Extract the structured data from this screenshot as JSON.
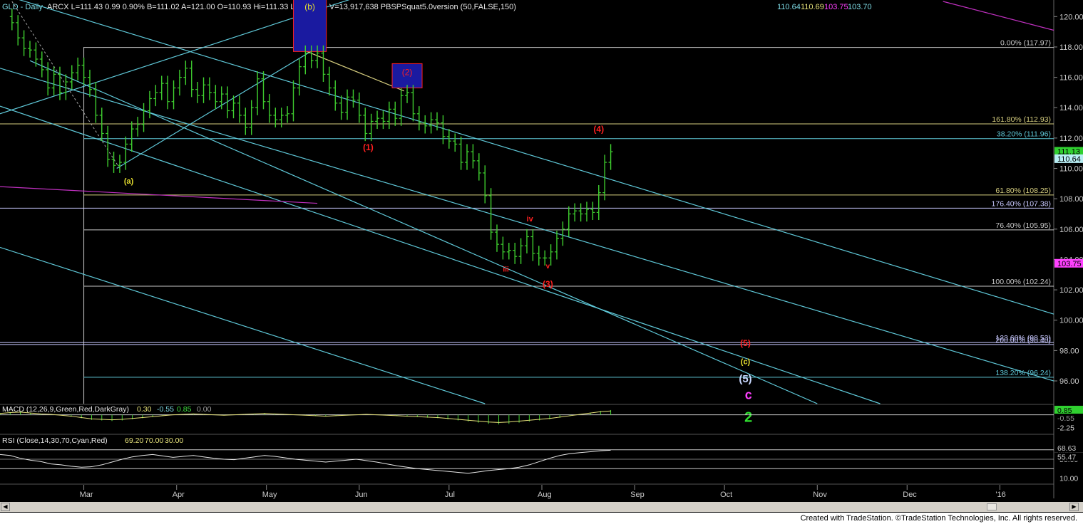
{
  "header": {
    "symbol": "GLD - Daily",
    "quote": "ARCX  L=111.43  0.99  0.90%  B=111.02  A=121.00  O=110.93  Hi=111.33  Lo=110.12  V=13,917,638  PBSPSquat5.0version (50,FALSE,150)",
    "ind_values": [
      {
        "text": "110.64",
        "color": "#7fdce6"
      },
      {
        "text": "110.69",
        "color": "#e6e27a"
      },
      {
        "text": "103.75",
        "color": "#ff40ff"
      },
      {
        "text": "103.70",
        "color": "#7fdce6"
      }
    ]
  },
  "colors": {
    "background": "#000000",
    "bars": "#3fcf2f",
    "channel": "#5fc8d8",
    "fib_grid": "#c8c8c8",
    "fib_tan": "#d8d080",
    "magenta": "#c030c0",
    "red_label": "#ff2020",
    "yellow_label": "#e8e030",
    "macd_zero": "#c8c8c8",
    "rsi": "#c8c8c8"
  },
  "chart_data": {
    "type": "ohlc",
    "symbol": "GLD",
    "interval": "Daily",
    "ylim": [
      94.5,
      121
    ],
    "y_ticks": [
      96,
      98,
      100,
      102,
      104,
      106,
      108,
      110,
      112,
      114,
      116,
      118,
      120
    ],
    "y_tick_labels": [
      "96.00",
      "98.00",
      "100.00",
      "102.00",
      "104.00",
      "106.00",
      "108.00",
      "110.00",
      "112.00",
      "114.00",
      "116.00",
      "118.00",
      "120.00"
    ],
    "x_months": [
      {
        "label": "Mar",
        "day": 28
      },
      {
        "label": "Apr",
        "day": 59
      },
      {
        "label": "May",
        "day": 89
      },
      {
        "label": "Jun",
        "day": 120
      },
      {
        "label": "Jul",
        "day": 150
      },
      {
        "label": "Aug",
        "day": 181
      },
      {
        "label": "Sep",
        "day": 212
      },
      {
        "label": "Oct",
        "day": 242
      },
      {
        "label": "Nov",
        "day": 273
      },
      {
        "label": "Dec",
        "day": 303
      },
      {
        "label": "'16",
        "day": 334
      }
    ],
    "x_range_days": [
      0,
      352
    ],
    "closes": [
      [
        4,
        119.6
      ],
      [
        6,
        118.6
      ],
      [
        8,
        117.9
      ],
      [
        10,
        117.8
      ],
      [
        12,
        117.2
      ],
      [
        14,
        116.5
      ],
      [
        16,
        115.3
      ],
      [
        18,
        116.2
      ],
      [
        20,
        115.0
      ],
      [
        22,
        115.7
      ],
      [
        24,
        116.3
      ],
      [
        26,
        116.8
      ],
      [
        28,
        116.0
      ],
      [
        30,
        115.2
      ],
      [
        32,
        113.5
      ],
      [
        34,
        112.3
      ],
      [
        36,
        110.6
      ],
      [
        38,
        110.2
      ],
      [
        40,
        110.4
      ],
      [
        42,
        111.6
      ],
      [
        44,
        112.6
      ],
      [
        46,
        112.9
      ],
      [
        48,
        113.8
      ],
      [
        50,
        114.6
      ],
      [
        52,
        115.0
      ],
      [
        54,
        115.6
      ],
      [
        56,
        114.4
      ],
      [
        58,
        115.3
      ],
      [
        60,
        116.0
      ],
      [
        62,
        116.6
      ],
      [
        64,
        115.2
      ],
      [
        66,
        114.8
      ],
      [
        68,
        115.5
      ],
      [
        70,
        115.0
      ],
      [
        72,
        114.4
      ],
      [
        74,
        114.9
      ],
      [
        76,
        113.8
      ],
      [
        78,
        114.3
      ],
      [
        80,
        113.5
      ],
      [
        82,
        112.7
      ],
      [
        84,
        114.0
      ],
      [
        86,
        115.9
      ],
      [
        88,
        114.4
      ],
      [
        90,
        113.5
      ],
      [
        92,
        113.2
      ],
      [
        94,
        113.5
      ],
      [
        96,
        113.6
      ],
      [
        98,
        115.3
      ],
      [
        100,
        116.7
      ],
      [
        102,
        117.6
      ],
      [
        104,
        117.1
      ],
      [
        106,
        117.6
      ],
      [
        108,
        116.2
      ],
      [
        110,
        115.3
      ],
      [
        112,
        114.3
      ],
      [
        114,
        113.7
      ],
      [
        116,
        114.7
      ],
      [
        118,
        114.5
      ],
      [
        120,
        113.5
      ],
      [
        122,
        112.3
      ],
      [
        124,
        113.1
      ],
      [
        126,
        113.3
      ],
      [
        128,
        113.1
      ],
      [
        130,
        113.9
      ],
      [
        132,
        113.3
      ],
      [
        134,
        114.8
      ],
      [
        136,
        115.0
      ],
      [
        138,
        113.6
      ],
      [
        140,
        113.0
      ],
      [
        142,
        112.8
      ],
      [
        144,
        113.2
      ],
      [
        146,
        113.0
      ],
      [
        148,
        112.1
      ],
      [
        150,
        111.8
      ],
      [
        152,
        111.6
      ],
      [
        154,
        110.4
      ],
      [
        156,
        111.1
      ],
      [
        158,
        110.5
      ],
      [
        160,
        109.7
      ],
      [
        162,
        108.2
      ],
      [
        164,
        105.8
      ],
      [
        166,
        105.0
      ],
      [
        168,
        104.5
      ],
      [
        170,
        104.6
      ],
      [
        172,
        104.2
      ],
      [
        174,
        104.9
      ],
      [
        176,
        105.5
      ],
      [
        178,
        104.4
      ],
      [
        180,
        104.1
      ],
      [
        182,
        104.1
      ],
      [
        184,
        104.5
      ],
      [
        186,
        105.4
      ],
      [
        188,
        106.0
      ],
      [
        190,
        107.0
      ],
      [
        192,
        107.2
      ],
      [
        194,
        107.0
      ],
      [
        196,
        107.3
      ],
      [
        198,
        107.1
      ],
      [
        200,
        108.4
      ],
      [
        202,
        110.4
      ],
      [
        204,
        111.1
      ]
    ],
    "fib_levels": [
      {
        "label": "0.00% (117.97)",
        "value": 117.97,
        "color": "#c8c8c8",
        "x_start_day": 28
      },
      {
        "label": "161.80% (112.93)",
        "value": 112.93,
        "color": "#d8d080",
        "x_start_day": 0
      },
      {
        "label": "38.20% (111.96)",
        "value": 111.96,
        "color": "#5fc8d8",
        "x_start_day": 28
      },
      {
        "label": "61.80% (108.25)",
        "value": 108.25,
        "color": "#d8d080",
        "x_start_day": 28
      },
      {
        "label": "176.40% (107.38)",
        "value": 107.38,
        "color": "#c8c8ff",
        "x_start_day": 0
      },
      {
        "label": "76.40% (105.95)",
        "value": 105.95,
        "color": "#c8c8c8",
        "x_start_day": 28
      },
      {
        "label": "100.00% (102.24)",
        "value": 102.24,
        "color": "#c8c8c8",
        "x_start_day": 28
      },
      {
        "label": "123.60% (98.53)",
        "value": 98.53,
        "color": "#c8c8ff",
        "x_start_day": 0
      },
      {
        "label": "200.00% (98.40)",
        "value": 98.4,
        "color": "#c8c8ff",
        "x_start_day": 0
      },
      {
        "label": "138.20% (96.24)",
        "value": 96.24,
        "color": "#5fc8d8",
        "x_start_day": 28
      }
    ],
    "channel_lines": [
      [
        [
          0,
          121.5
        ],
        [
          352,
          100.4
        ]
      ],
      [
        [
          0,
          116.6
        ],
        [
          352,
          96.0
        ]
      ],
      [
        [
          10,
          117.1
        ],
        [
          273,
          94.5
        ]
      ],
      [
        [
          0,
          114.1
        ],
        [
          294,
          94.5
        ]
      ],
      [
        [
          0,
          104.8
        ],
        [
          162,
          94.5
        ]
      ],
      [
        [
          0,
          113.6
        ],
        [
          118,
          121.2
        ]
      ],
      [
        [
          39,
          110.0
        ],
        [
          108,
          118.2
        ]
      ]
    ],
    "fan_lines": [
      [
        [
          100,
          117.9
        ],
        [
          135,
          115.1
        ]
      ],
      [
        [
          0,
          108.8
        ],
        [
          106,
          107.7
        ]
      ],
      [
        [
          315,
          121.0
        ],
        [
          352,
          119.1
        ]
      ]
    ],
    "boxes": [
      {
        "label": "(b)",
        "day0": 98,
        "day1": 109,
        "v0": 117.7,
        "v1": 121.2,
        "label_color": "#e8e030"
      },
      {
        "label": "(2)",
        "day0": 131,
        "day1": 141,
        "v0": 115.3,
        "v1": 116.9,
        "label_color": "#ff2020"
      }
    ],
    "wave_labels": [
      {
        "text": "(a)",
        "day": 43,
        "value": 109.0,
        "color": "#e8e030",
        "size": 11
      },
      {
        "text": "(1)",
        "day": 123,
        "value": 111.2,
        "color": "#ff2020",
        "size": 12
      },
      {
        "text": "(4)",
        "day": 200,
        "value": 112.4,
        "color": "#ff2020",
        "size": 12
      },
      {
        "text": "iv",
        "day": 177,
        "value": 106.5,
        "color": "#ff2020",
        "size": 11
      },
      {
        "text": "iii",
        "day": 169,
        "value": 103.2,
        "color": "#ff2020",
        "size": 10
      },
      {
        "text": "v",
        "day": 183,
        "value": 103.4,
        "color": "#ff2020",
        "size": 10
      },
      {
        "text": "(3)",
        "day": 183,
        "value": 102.2,
        "color": "#ff2020",
        "size": 12
      },
      {
        "text": "(5)",
        "day": 249,
        "value": 98.3,
        "color": "#ff2020",
        "size": 12
      },
      {
        "text": "(c)",
        "day": 249,
        "value": 97.1,
        "color": "#e8e030",
        "size": 11
      },
      {
        "text": "(5)",
        "day": 249,
        "value": 95.9,
        "color": "#c8d8ff",
        "size": 15
      },
      {
        "text": "c",
        "day": 250,
        "value": 94.8,
        "color": "#ff40ff",
        "size": 18
      },
      {
        "text": "2",
        "day": 250,
        "value": 93.3,
        "color": "#30e030",
        "size": 20
      }
    ],
    "price_tags": [
      {
        "text": "111.13",
        "value": 111.13,
        "bg": "#30d030",
        "fg": "#000"
      },
      {
        "text": "110.64",
        "value": 110.64,
        "bg": "#b8eef4",
        "fg": "#000"
      },
      {
        "text": "103.75",
        "value": 103.75,
        "bg": "#ff40ff",
        "fg": "#000"
      }
    ],
    "macd": {
      "title": "MACD (12,26,9,Green,Red,DarkGray)",
      "values": [
        {
          "text": "0.30",
          "color": "#e6e27a"
        },
        {
          "text": "-0.55",
          "color": "#7fdce6"
        },
        {
          "text": "0.85",
          "color": "#40e040"
        },
        {
          "text": "0.00",
          "color": "#a0a0a0"
        }
      ],
      "ylim": [
        -3.2,
        1.6
      ],
      "tags": [
        {
          "text": "0.85",
          "value": 0.85,
          "bg": "#30d030",
          "fg": "#000"
        },
        {
          "text": "-2.25",
          "value": -2.25,
          "bg": "#000",
          "fg": "#ddd"
        },
        {
          "text": "-0.55",
          "value": -0.55,
          "bg": "#000",
          "fg": "#999"
        }
      ],
      "hist": [
        0.3,
        0.5,
        0.6,
        0.4,
        0.2,
        0.1,
        -0.1,
        -0.3,
        -0.6,
        -0.9,
        -1.0,
        -1.1,
        -1.0,
        -0.8,
        -0.6,
        -0.4,
        -0.2,
        0.0,
        0.1,
        0.2,
        0.1,
        0.0,
        -0.1,
        0.0,
        0.1,
        0.2,
        0.3,
        0.2,
        0.1,
        0.0,
        -0.1,
        -0.2,
        -0.3,
        -0.2,
        -0.1,
        0.0,
        0.1,
        0.0,
        -0.1,
        -0.2,
        -0.3,
        -0.4,
        -0.5,
        -0.6,
        -0.8,
        -1.0,
        -1.2,
        -1.4,
        -1.6,
        -1.7,
        -1.6,
        -1.4,
        -1.2,
        -1.0,
        -0.8,
        -0.5,
        -0.2,
        0.1,
        0.4,
        0.7,
        0.85
      ]
    },
    "rsi": {
      "title": "RSI (Close,14,30,70,Cyan,Red)",
      "values": [
        {
          "text": "69.20",
          "color": "#e6e27a"
        },
        {
          "text": "70.00",
          "color": "#e6e27a"
        },
        {
          "text": "30.00",
          "color": "#e6e27a"
        }
      ],
      "ylim": [
        0,
        100
      ],
      "ticks": [
        {
          "text": "10.00",
          "value": 10
        },
        {
          "text": "50.00",
          "value": 50
        }
      ],
      "tags": [
        {
          "text": "69.20",
          "value": 69.2,
          "bg": "#a0a0a0",
          "fg": "#000"
        },
        {
          "text": "68.63",
          "value": 74,
          "bg": "#000",
          "fg": "#ccc"
        },
        {
          "text": "55.47",
          "value": 55.5,
          "bg": "#000",
          "fg": "#ccc"
        }
      ],
      "series": [
        60,
        58,
        52,
        48,
        45,
        40,
        38,
        35,
        33,
        34,
        38,
        44,
        50,
        55,
        58,
        60,
        57,
        54,
        56,
        58,
        55,
        52,
        50,
        49,
        52,
        55,
        58,
        56,
        53,
        50,
        48,
        46,
        44,
        46,
        48,
        50,
        47,
        44,
        40,
        36,
        33,
        30,
        28,
        26,
        24,
        22,
        20,
        23,
        26,
        28,
        30,
        33,
        38,
        45,
        52,
        58,
        62,
        64,
        66,
        68,
        69.2
      ]
    }
  },
  "footer": {
    "text": "Created with TradeStation. ©TradeStation Technologies, Inc. All rights reserved."
  }
}
